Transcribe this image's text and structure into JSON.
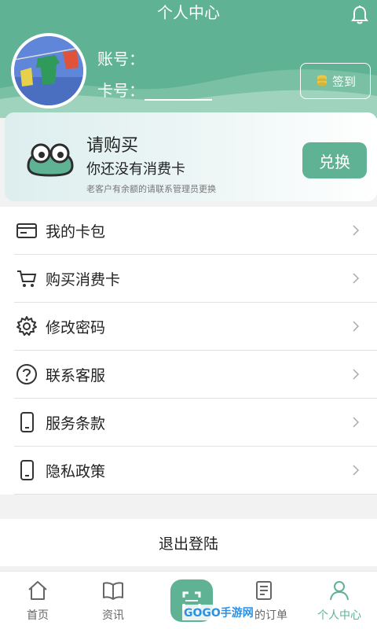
{
  "header": {
    "title": "个人中心",
    "account_label": "账号：",
    "card_label": "卡号：",
    "signin_label": "签到",
    "bell_icon": "bell-icon",
    "accent_color": "#5fb394"
  },
  "promo": {
    "title": "请购买",
    "subtitle": "你还没有消费卡",
    "note": "老客户有余额的请联系管理员更换",
    "button_label": "兑换"
  },
  "menu": {
    "items": [
      {
        "label": "我的卡包",
        "icon": "wallet-icon"
      },
      {
        "label": "购买消费卡",
        "icon": "cart-icon"
      },
      {
        "label": "修改密码",
        "icon": "gear-icon"
      },
      {
        "label": "联系客服",
        "icon": "help-icon"
      },
      {
        "label": "服务条款",
        "icon": "phone-icon"
      },
      {
        "label": "隐私政策",
        "icon": "phone-icon"
      }
    ]
  },
  "logout_label": "退出登陆",
  "tabbar": {
    "tabs": [
      {
        "label": "首页",
        "icon": "home-icon"
      },
      {
        "label": "资讯",
        "icon": "book-icon"
      },
      {
        "label": "",
        "icon": "scan-icon"
      },
      {
        "label": "的订单",
        "icon": "order-icon"
      },
      {
        "label": "个人中心",
        "icon": "user-icon"
      }
    ],
    "watermark": "GOGO手游网"
  }
}
